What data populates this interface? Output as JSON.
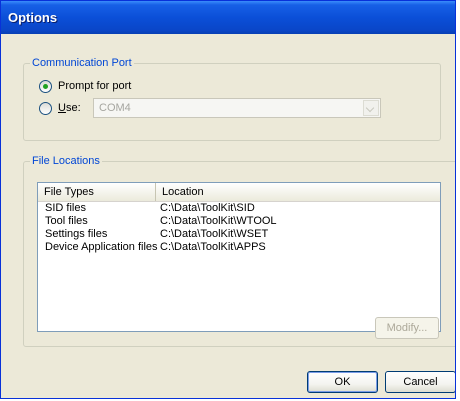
{
  "window": {
    "title": "Options"
  },
  "comm_port": {
    "legend": "Communication Port",
    "prompt_label": "Prompt for port",
    "use_label_u": "U",
    "use_label_rest": "se:",
    "combo_value": "COM4"
  },
  "file_locations": {
    "legend": "File Locations",
    "columns": [
      "File Types",
      "Location"
    ],
    "rows": [
      {
        "type": "SID files",
        "location": "C:\\Data\\ToolKit\\SID"
      },
      {
        "type": "Tool files",
        "location": "C:\\Data\\ToolKit\\WTOOL"
      },
      {
        "type": "Settings files",
        "location": "C:\\Data\\ToolKit\\WSET"
      },
      {
        "type": "Device Application files",
        "location": "C:\\Data\\ToolKit\\APPS"
      }
    ],
    "modify_label": "Modify..."
  },
  "buttons": {
    "ok": "OK",
    "cancel": "Cancel"
  }
}
